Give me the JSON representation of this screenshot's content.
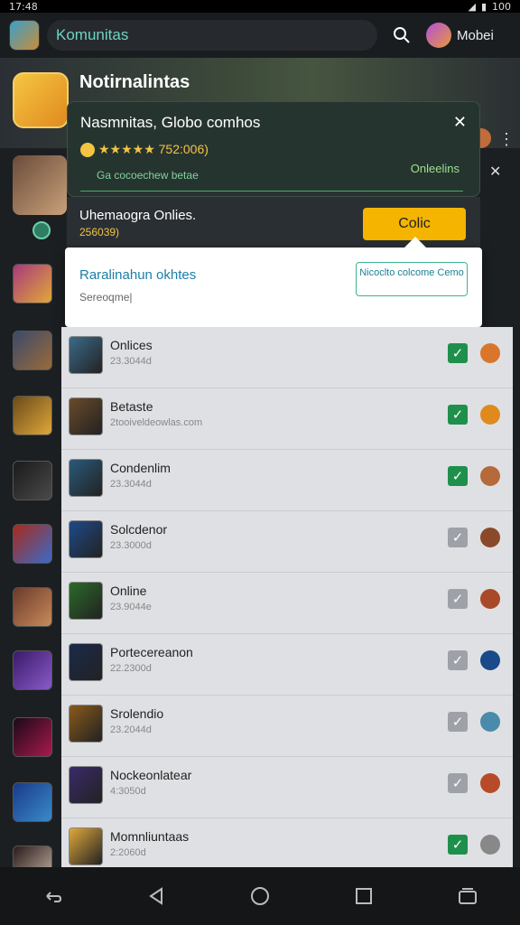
{
  "status": {
    "time": "17:48",
    "battery": "100"
  },
  "appbar": {
    "search_text": "Komunitas",
    "user_name": "Mobei"
  },
  "banner": {
    "title": "Notirnalintas"
  },
  "notification": {
    "title": "Nasmnitas, Globo comhos",
    "rating_text": "★★★★★ 752:006)",
    "sub_text": "Ga cocoechew betae",
    "online_text": "Onleelins"
  },
  "row2": {
    "label": "Uhemaogra Onlies.",
    "sub": "256039)",
    "button": "Colic"
  },
  "popup": {
    "title": "Raralinahun okhtes",
    "sub": "Sereoqme|",
    "button": "Nicoclto colcome Cemo"
  },
  "list_items": [
    {
      "name": "Onlices",
      "sub": "23.3044d",
      "checked": true,
      "thumb": "#3b6a8a",
      "end": "#d9762b"
    },
    {
      "name": "Betaste",
      "sub": "2tooiveldeowlas.com",
      "checked": true,
      "thumb": "#6a4a2a",
      "end": "#e08a1e"
    },
    {
      "name": "Condenlim",
      "sub": "23.3044d",
      "checked": true,
      "thumb": "#2a5a7a",
      "end": "#b56a3a"
    },
    {
      "name": "Solcdenor",
      "sub": "23.3000d",
      "checked": false,
      "thumb": "#1e4a8a",
      "end": "#8a4a2a"
    },
    {
      "name": "Online",
      "sub": "23.9044e",
      "checked": false,
      "thumb": "#2a6a2a",
      "end": "#a84a2a"
    },
    {
      "name": "Portecereanon",
      "sub": "22.2300d",
      "checked": false,
      "thumb": "#1a2a4a",
      "end": "#1a4a8a"
    },
    {
      "name": "Srolendio",
      "sub": "23.2044d",
      "checked": false,
      "thumb": "#8a5a1a",
      "end": "#4a8aaa"
    },
    {
      "name": "Nockeonlatear",
      "sub": "4:3050d",
      "checked": false,
      "thumb": "#3a2a6a",
      "end": "#b84a2a"
    },
    {
      "name": "Momnliuntaas",
      "sub": "2:2060d",
      "checked": true,
      "thumb": "#e0a83a",
      "end": "#888888"
    }
  ],
  "nav": [
    "back",
    "home-triangle",
    "home",
    "recents",
    "window"
  ]
}
